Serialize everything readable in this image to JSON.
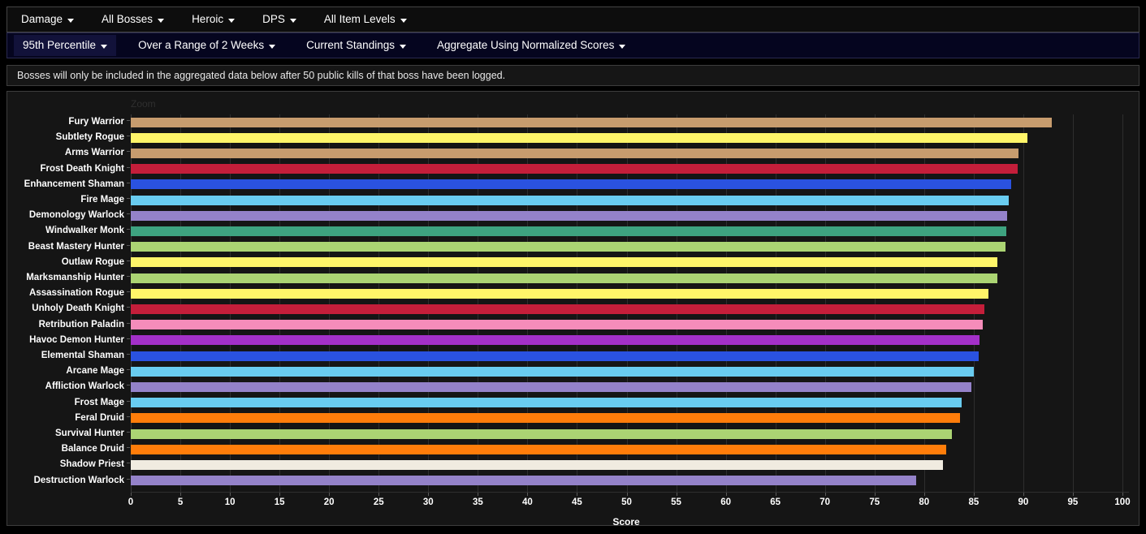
{
  "menubar_primary": {
    "items": [
      {
        "label": "Damage",
        "caret": "chevron-down-icon"
      },
      {
        "label": "All Bosses",
        "caret": "chevron-down-icon"
      },
      {
        "label": "Heroic",
        "caret": "chevron-down-icon"
      },
      {
        "label": "DPS",
        "caret": "chevron-down-icon"
      },
      {
        "label": "All Item Levels",
        "caret": "chevron-down-icon"
      }
    ]
  },
  "menubar_secondary": {
    "items": [
      {
        "label": "95th Percentile",
        "caret": "chevron-down-icon",
        "highlighted": true
      },
      {
        "label": "Over a Range of 2 Weeks",
        "caret": "chevron-down-icon",
        "highlighted": false
      },
      {
        "label": "Current Standings",
        "caret": "chevron-down-icon",
        "highlighted": false
      },
      {
        "label": "Aggregate Using Normalized Scores",
        "caret": "chevron-down-icon",
        "highlighted": false
      }
    ]
  },
  "notice": {
    "text": "Bosses will only be included in the aggregated data below after 50 public kills of that boss have been logged."
  },
  "chart_panel": {
    "zoom_label": "Zoom"
  },
  "chart_data": {
    "type": "bar",
    "orientation": "horizontal",
    "title": "",
    "xlabel": "Score",
    "ylabel": "",
    "xlim": [
      0,
      100
    ],
    "ylim": null,
    "grid": true,
    "legend": false,
    "xticks": [
      0,
      5,
      10,
      15,
      20,
      25,
      30,
      35,
      40,
      45,
      50,
      55,
      60,
      65,
      70,
      75,
      80,
      85,
      90,
      95,
      100
    ],
    "categories": [
      "Fury Warrior",
      "Subtlety Rogue",
      "Arms Warrior",
      "Frost Death Knight",
      "Enhancement Shaman",
      "Fire Mage",
      "Demonology Warlock",
      "Windwalker Monk",
      "Beast Mastery Hunter",
      "Outlaw Rogue",
      "Marksmanship Hunter",
      "Assassination Rogue",
      "Unholy Death Knight",
      "Retribution Paladin",
      "Havoc Demon Hunter",
      "Elemental Shaman",
      "Arcane Mage",
      "Affliction Warlock",
      "Frost Mage",
      "Feral Druid",
      "Survival Hunter",
      "Balance Druid",
      "Shadow Priest",
      "Destruction Warlock"
    ],
    "values": [
      92.9,
      90.4,
      89.5,
      89.4,
      88.8,
      88.5,
      88.4,
      88.3,
      88.2,
      87.4,
      87.4,
      86.5,
      86.1,
      85.9,
      85.6,
      85.5,
      85.0,
      84.8,
      83.8,
      83.6,
      82.8,
      82.2,
      81.9,
      79.2
    ],
    "colors": [
      "#C79C6E",
      "#FFF569",
      "#C79C6E",
      "#C41E3A",
      "#2A52E0",
      "#69CCF0",
      "#9482C9",
      "#3EA380",
      "#ABD473",
      "#FFF569",
      "#ABD473",
      "#FFF569",
      "#C41E3A",
      "#F58CBA",
      "#A330C9",
      "#2A52E0",
      "#69CCF0",
      "#9482C9",
      "#69CCF0",
      "#FF7D0A",
      "#ABD473",
      "#FF7D0A",
      "#F0EBE0",
      "#9482C9"
    ]
  }
}
